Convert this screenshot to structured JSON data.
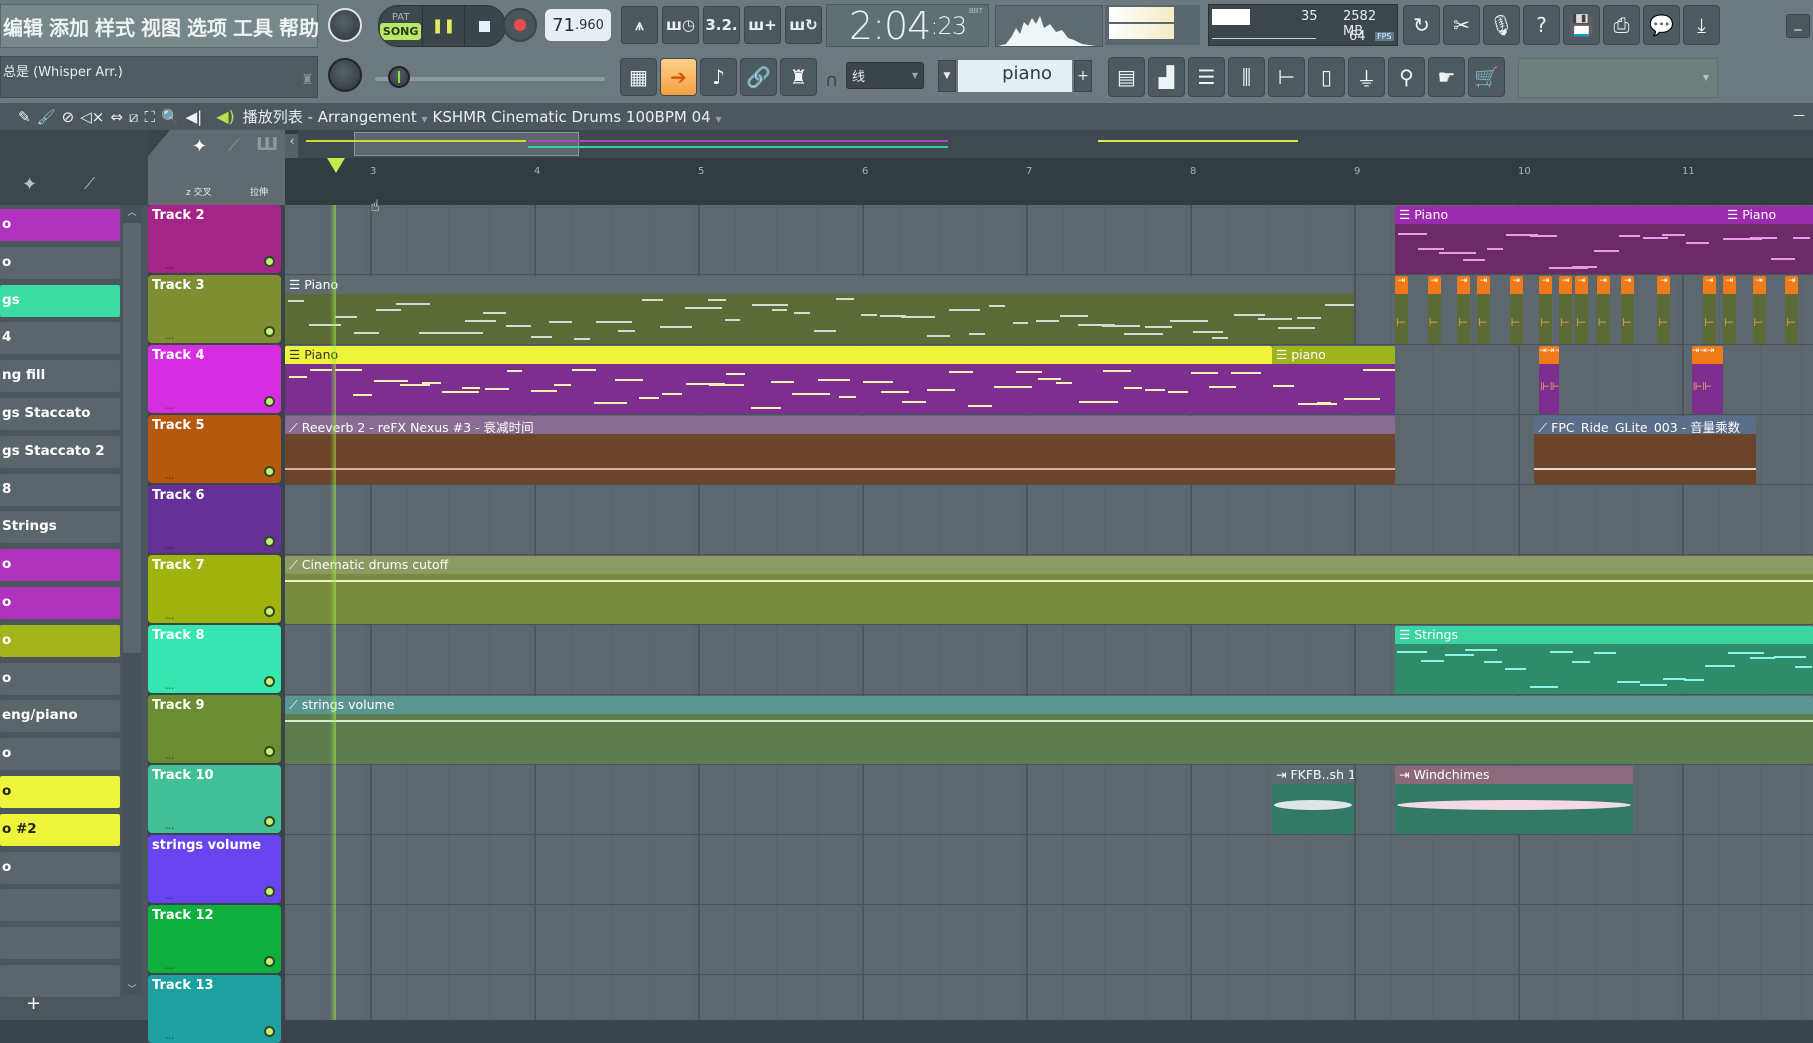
{
  "menu": [
    "编辑",
    "添加",
    "样式",
    "视图",
    "选项",
    "工具",
    "帮助"
  ],
  "hint_text": "总是 (Whisper Arr.)",
  "transport": {
    "pat_label": "PAT",
    "song_label": "SONG",
    "play_icon": "pause-icon",
    "stop_icon": "stop-icon",
    "record_icon": "record-icon",
    "tempo_main": "71",
    "tempo_decimal": ".960",
    "time_main": "2:04",
    "time_sub": ":23",
    "time_format": "B:B:T"
  },
  "transport_buttons": [
    {
      "name": "metronome-button",
      "glyph": "⩚"
    },
    {
      "name": "wait-for-input-button",
      "glyph": "ш◷"
    },
    {
      "name": "countdown-button",
      "glyph": "3.2."
    },
    {
      "name": "step-edit-button",
      "glyph": "ш+"
    },
    {
      "name": "loop-record-button",
      "glyph": "ш↻"
    }
  ],
  "stats": {
    "cpu": "35",
    "memory": "2582 MB",
    "polyphony": "64",
    "fps_label": "FPS"
  },
  "top_right_buttons": [
    {
      "name": "undo-history-button",
      "glyph": "↻"
    },
    {
      "name": "cut-audio-button",
      "glyph": "✂"
    },
    {
      "name": "record-audio-button",
      "glyph": "🎙"
    },
    {
      "name": "help-button",
      "glyph": "?"
    },
    {
      "name": "save-button",
      "glyph": "💾"
    },
    {
      "name": "save-audio-button",
      "glyph": "⎙"
    },
    {
      "name": "chat-button",
      "glyph": "💬"
    },
    {
      "name": "download-button",
      "glyph": "⤓"
    }
  ],
  "window_minimize": "_",
  "row2_buttons": [
    {
      "name": "piano-roll-view-button",
      "glyph": "▦",
      "active": false
    },
    {
      "name": "step-arrow-button",
      "glyph": "➔",
      "active": true
    },
    {
      "name": "brush-button",
      "glyph": "♪",
      "active": false
    },
    {
      "name": "link-button",
      "glyph": "🔗",
      "active": false
    },
    {
      "name": "stamp-button",
      "glyph": "♜",
      "active": false
    }
  ],
  "snap": {
    "label": "线"
  },
  "pattern_selector": {
    "value": "piano",
    "plus": "+"
  },
  "window_buttons": [
    {
      "name": "playlist-window-button",
      "glyph": "▤"
    },
    {
      "name": "piano-roll-window-button",
      "glyph": "▟"
    },
    {
      "name": "channel-rack-window-button",
      "glyph": "☰"
    },
    {
      "name": "mixer-window-button",
      "glyph": "⫼"
    },
    {
      "name": "browser-window-button",
      "glyph": "⊢"
    },
    {
      "name": "project-window-button",
      "glyph": "▯"
    },
    {
      "name": "plugin-database-button",
      "glyph": "⏚"
    },
    {
      "name": "drum-pedal-button",
      "glyph": "⚲"
    },
    {
      "name": "touch-controller-button",
      "glyph": "☛"
    },
    {
      "name": "shop-button",
      "glyph": "🛒"
    }
  ],
  "playlist": {
    "title_prefix": "播放列表",
    "title_sep": " - ",
    "title_view": "Arrangement",
    "title_pattern": "KSHMR Cinematic Drums 100BPM 04",
    "tools": [
      {
        "name": "draw-tool",
        "glyph": "✎"
      },
      {
        "name": "paint-tool",
        "glyph": "🖌"
      },
      {
        "name": "delete-tool",
        "glyph": "⊘"
      },
      {
        "name": "mute-tool",
        "glyph": "◁×"
      },
      {
        "name": "slip-tool",
        "glyph": "⇔"
      },
      {
        "name": "slice-tool",
        "glyph": "⧄"
      },
      {
        "name": "select-tool",
        "glyph": "⛶"
      },
      {
        "name": "zoom-tool",
        "glyph": "🔍"
      },
      {
        "name": "playback-tool",
        "glyph": "◀|"
      }
    ],
    "corner_crossfade": "z 交叉",
    "corner_stretch": "拉伸",
    "ruler_bars": [
      "3",
      "4",
      "5",
      "6",
      "7",
      "8",
      "9",
      "10",
      "11"
    ]
  },
  "patterns": [
    {
      "label": "o",
      "color": "#b033be",
      "text_color": "#fff"
    },
    {
      "label": "o",
      "color": "#5a666b",
      "text_color": "#fff"
    },
    {
      "label": "gs",
      "color": "#3bdca3",
      "text_color": "#fff"
    },
    {
      "label": "4",
      "color": "#5a666b",
      "text_color": "#fff"
    },
    {
      "label": "ng fill",
      "color": "#5a666b",
      "text_color": "#fff"
    },
    {
      "label": "gs Staccato",
      "color": "#5a666b",
      "text_color": "#fff"
    },
    {
      "label": "gs Staccato 2",
      "color": "#5a666b",
      "text_color": "#fff"
    },
    {
      "label": "8",
      "color": "#5a666b",
      "text_color": "#fff"
    },
    {
      "label": "Strings",
      "color": "#5a666b",
      "text_color": "#fff"
    },
    {
      "label": "o",
      "color": "#b033be",
      "text_color": "#fff"
    },
    {
      "label": "o",
      "color": "#b033be",
      "text_color": "#fff"
    },
    {
      "label": "o",
      "color": "#a3b41c",
      "text_color": "#fff"
    },
    {
      "label": "o",
      "color": "#5a666b",
      "text_color": "#fff"
    },
    {
      "label": "eng/piano",
      "color": "#5a666b",
      "text_color": "#fff"
    },
    {
      "label": "o",
      "color": "#5a666b",
      "text_color": "#fff"
    },
    {
      "label": "o",
      "color": "#eef43a",
      "text_color": "#222"
    },
    {
      "label": "o #2",
      "color": "#eef43a",
      "text_color": "#222"
    },
    {
      "label": "o",
      "color": "#5a666b",
      "text_color": "#fff"
    },
    {
      "label": "",
      "color": "#5a666b",
      "text_color": "#fff"
    },
    {
      "label": "",
      "color": "#5a666b",
      "text_color": "#fff"
    },
    {
      "label": "",
      "color": "#5a666b",
      "text_color": "#fff"
    }
  ],
  "add_pattern": "+",
  "tracks": [
    {
      "label": "Track 2",
      "color": "#a42488"
    },
    {
      "label": "Track 3",
      "color": "#7f8e33"
    },
    {
      "label": "Track 4",
      "color": "#d42ee0"
    },
    {
      "label": "Track 5",
      "color": "#b5590f"
    },
    {
      "label": "Track 6",
      "color": "#663196"
    },
    {
      "label": "Track 7",
      "color": "#a0b30f"
    },
    {
      "label": "Track 8",
      "color": "#36e6b0"
    },
    {
      "label": "Track 9",
      "color": "#6a8d33"
    },
    {
      "label": "Track 10",
      "color": "#41c097"
    },
    {
      "label": "strings volume",
      "color": "#6845f0"
    },
    {
      "label": "Track 12",
      "color": "#0faf3d"
    },
    {
      "label": "Track 13",
      "color": "#1ea0a0"
    }
  ],
  "clips": [
    {
      "track": 0,
      "label": "Piano",
      "kind": "pattern",
      "start": 9.25,
      "end": 11.25,
      "head": "#9b2aae",
      "body": "#6d2a68",
      "note": "#e79be8"
    },
    {
      "track": 0,
      "label": "Piano",
      "kind": "pattern",
      "start": 11.25,
      "end": 12.6,
      "head": "#9b2aae",
      "body": "#6d2a68",
      "note": "#e79be8"
    },
    {
      "track": 1,
      "label": "Piano",
      "kind": "pattern",
      "start": 2.0,
      "end": 9.0,
      "head": "#5d6b70",
      "body": "#5c6a35",
      "note": "#d3dad3"
    },
    {
      "track": 2,
      "label": "Piano",
      "kind": "pattern",
      "start": 2.0,
      "end": 8.5,
      "head": "#eef43a",
      "body": "#7c2f8e",
      "note": "#f8f3b2",
      "dark": true
    },
    {
      "track": 2,
      "label": "piano",
      "kind": "pattern",
      "start": 8.5,
      "end": 9.25,
      "head": "#9cb51e",
      "body": "#7c2f8e",
      "note": "#f8f3b2"
    },
    {
      "track": 3,
      "label": "Reeverb 2 - reFX Nexus #3 - 衰减时间",
      "kind": "automation",
      "start": 2.0,
      "end": 9.25,
      "head": "#8a6c93",
      "body": "#6b452a",
      "note": "#d9a9a8"
    },
    {
      "track": 3,
      "label": "FPC_Ride_GLite_003 - 音量乘数",
      "kind": "automation",
      "start": 10.1,
      "end": 11.45,
      "head": "#5a6e8a",
      "body": "#6b452a",
      "note": "#e3d7d0"
    },
    {
      "track": 5,
      "label": "Cinematic drums cutoff",
      "kind": "automation",
      "start": 2.0,
      "end": 12.6,
      "head": "#8c9b63",
      "body": "#778c3e",
      "note": "#f3f0bd"
    },
    {
      "track": 6,
      "label": "Strings",
      "kind": "pattern",
      "start": 9.25,
      "end": 12.6,
      "head": "#3cd4a0",
      "body": "#2f8c6a",
      "note": "#8cf4e4"
    },
    {
      "track": 7,
      "label": "strings volume",
      "kind": "automation",
      "start": 2.0,
      "end": 12.6,
      "head": "#5a9591",
      "body": "#5e7d4f",
      "note": "#d8ecd0"
    },
    {
      "track": 8,
      "label": "FKFB..sh 1",
      "kind": "audio",
      "start": 8.5,
      "end": 9.0,
      "head": "#5b6b70",
      "body": "#327a66",
      "note": "#dde5ea"
    },
    {
      "track": 8,
      "label": "Windchimes",
      "kind": "audio",
      "start": 9.25,
      "end": 10.7,
      "head": "#8d6a7b",
      "body": "#327a66",
      "note": "#f3d9e3"
    }
  ],
  "drum_hits": {
    "track": 1,
    "positions": [
      9.25,
      9.45,
      9.63,
      9.75,
      9.95,
      10.13,
      10.25,
      10.35,
      10.48,
      10.63,
      10.85,
      11.13,
      11.25,
      11.43,
      11.63,
      11.8
    ],
    "color": "#f07a18"
  },
  "drum_rolls": [
    {
      "track": 2,
      "start": 10.13,
      "end": 10.25
    },
    {
      "track": 2,
      "start": 11.06,
      "end": 11.25
    }
  ]
}
